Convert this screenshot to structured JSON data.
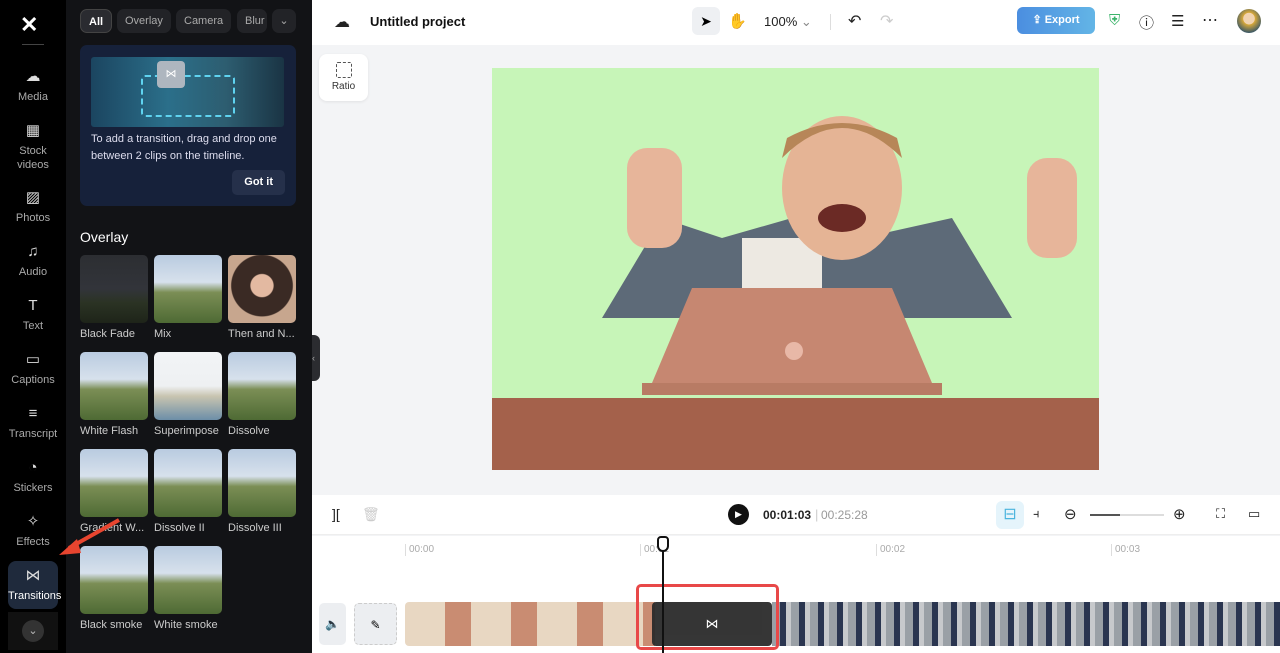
{
  "rail": {
    "items": [
      {
        "label": "Media",
        "icon": "cloud-upload-icon"
      },
      {
        "label": "Stock videos",
        "icon": "film-icon"
      },
      {
        "label": "Photos",
        "icon": "image-icon"
      },
      {
        "label": "Audio",
        "icon": "music-icon"
      },
      {
        "label": "Text",
        "icon": "text-icon"
      },
      {
        "label": "Captions",
        "icon": "captions-icon"
      },
      {
        "label": "Transcript",
        "icon": "transcript-icon"
      },
      {
        "label": "Stickers",
        "icon": "sticker-icon"
      },
      {
        "label": "Effects",
        "icon": "sparkle-icon"
      },
      {
        "label": "Transitions",
        "icon": "transition-icon",
        "active": true
      }
    ]
  },
  "panel": {
    "chips": [
      "All",
      "Overlay",
      "Camera",
      "Blur"
    ],
    "tip": {
      "text": "To add a transition, drag and drop one between 2 clips on the timeline.",
      "button": "Got it"
    },
    "section": "Overlay",
    "tiles": [
      "Black Fade",
      "Mix",
      "Then and N...",
      "White Flash",
      "Superimpose",
      "Dissolve",
      "Gradient W...",
      "Dissolve II",
      "Dissolve III",
      "Black smoke",
      "White smoke"
    ]
  },
  "topbar": {
    "project": "Untitled project",
    "zoom": "100%",
    "export": "Export"
  },
  "ratio": "Ratio",
  "timeline": {
    "current": "00:01:03",
    "total": "00:25:28",
    "ticks": [
      "00:00",
      "00:01",
      "00:02",
      "00:03"
    ]
  },
  "colors": {
    "accent": "#4b8ee0",
    "preview_bg": "#c7f5b8",
    "highlight": "#e84848"
  }
}
